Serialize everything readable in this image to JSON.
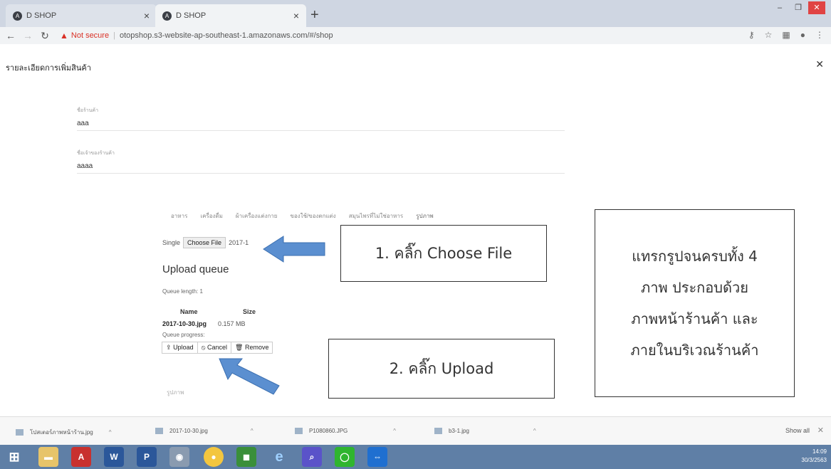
{
  "browser": {
    "tabs": [
      {
        "label": "D SHOP"
      },
      {
        "label": "D SHOP"
      }
    ],
    "new_tab": "+",
    "not_secure": "Not secure",
    "url": "otopshop.s3-website-ap-southeast-1.amazonaws.com/#/shop"
  },
  "dialog": {
    "title": "รายละเอียดการเพิ่มสินค้า",
    "fields": [
      {
        "label": "ชื่อร้านค้า",
        "value": "aaa"
      },
      {
        "label": "ชื่อเจ้าของร้านค้า",
        "value": "aaaa"
      }
    ],
    "categories": [
      "อาหาร",
      "เครื่องดื่ม",
      "ผ้าเครื่องแต่งกาย",
      "ของใช้/ของตกแต่ง",
      "สมุนไพรที่ไม่ใช่อาหาร",
      "รูปภาพ"
    ],
    "single_label": "Single",
    "choose_file": "Choose File",
    "chosen_file": "2017-1",
    "upload_queue_title": "Upload queue",
    "queue_length": "Queue length: 1",
    "table_headers": {
      "name": "Name",
      "size": "Size"
    },
    "file": {
      "name": "2017-10-30.jpg",
      "size": "0.157 MB"
    },
    "queue_progress": "Queue progress:",
    "buttons": {
      "upload": "Upload",
      "cancel": "Cancel",
      "remove": "Remove"
    },
    "image_label": "รูปภาพ"
  },
  "callouts": {
    "step1": "1. คลิ๊ก Choose File",
    "step2": "2. คลิ๊ก Upload",
    "note": [
      "แทรกรูปจนครบทั้ง 4",
      "ภาพ ประกอบด้วย",
      "ภาพหน้าร้านค้า และ",
      "ภายในบริเวณร้านค้า"
    ]
  },
  "downloads": {
    "items": [
      "โปสเตอร์ภาพหน้าร้าน.jpg",
      "2017-10-30.jpg",
      "P1080860.JPG",
      "b3-1.jpg"
    ],
    "show_all": "Show all"
  },
  "taskbar": {
    "time": "14:09",
    "date": "30/3/2563"
  },
  "colors": {
    "accent": "#5b8fc0",
    "arrow": "#5b8fd0",
    "taskbar": "#5f7fa6",
    "warning": "#d93025"
  }
}
